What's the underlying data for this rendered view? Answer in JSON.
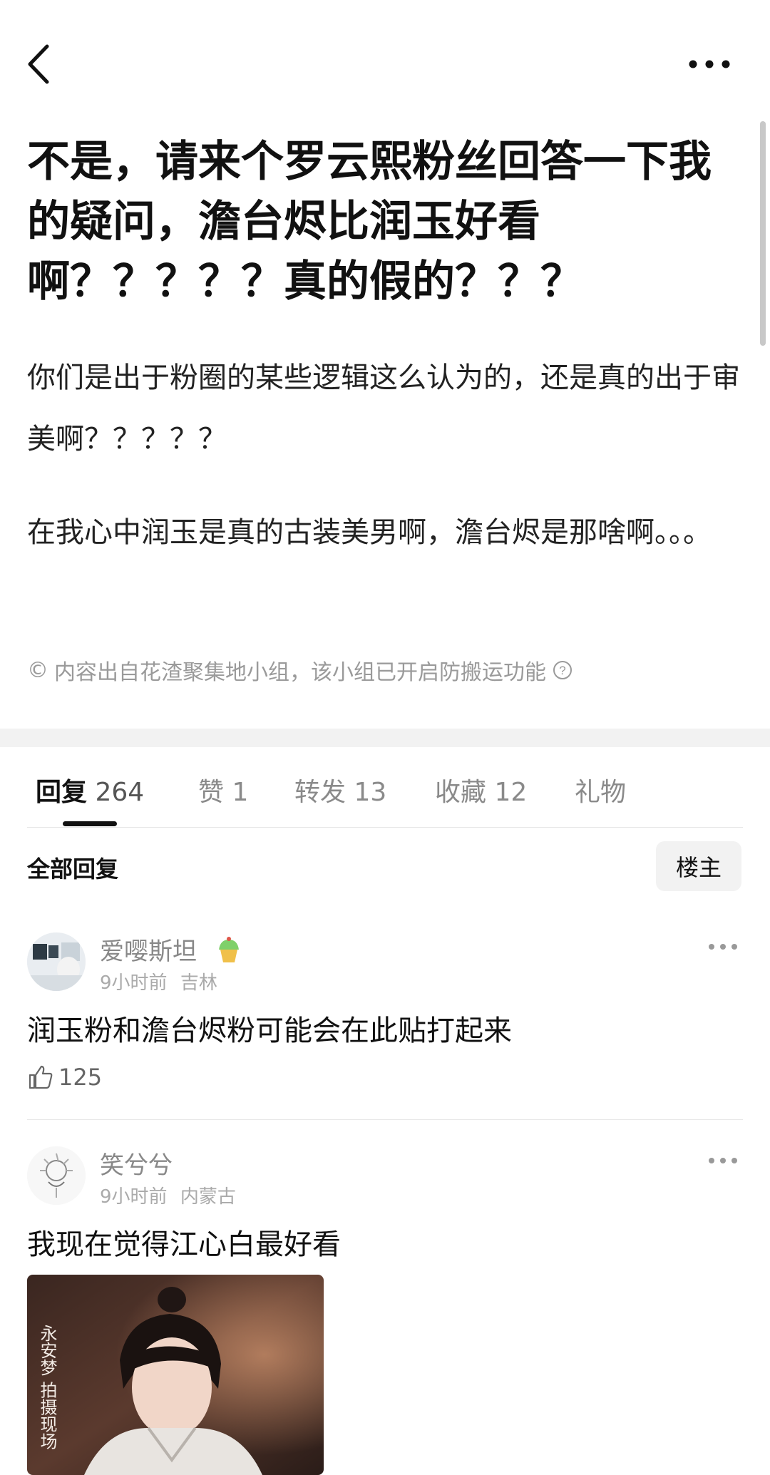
{
  "post": {
    "title": "不是，请来个罗云熙粉丝回答一下我的疑问，澹台烬比润玉好看啊？？？？？真的假的？？？",
    "paragraphs": [
      "你们是出于粉圈的某些逻辑这么认为的，还是真的出于审美啊？？？？？",
      "在我心中润玉是真的古装美男啊，澹台烬是那啥啊。。。"
    ],
    "notice": "内容出自花渣聚集地小组，该小组已开启防搬运功能"
  },
  "tabs": [
    {
      "label": "回复",
      "count": "264"
    },
    {
      "label": "赞",
      "count": "1"
    },
    {
      "label": "转发",
      "count": "13"
    },
    {
      "label": "收藏",
      "count": "12"
    },
    {
      "label": "礼物",
      "count": ""
    }
  ],
  "filter": {
    "all_replies": "全部回复",
    "op_only": "楼主"
  },
  "comments": [
    {
      "username": "爱嘤斯坦",
      "time": "9小时前",
      "location": "吉林",
      "text": "润玉粉和澹台烬粉可能会在此贴打起来",
      "likes": "125"
    },
    {
      "username": "笑兮兮",
      "time": "9小时前",
      "location": "内蒙古",
      "text": "我现在觉得江心白最好看",
      "image_caption": "永安梦 拍摄现场"
    }
  ],
  "colors": {
    "text_primary": "#111111",
    "text_secondary": "#888888",
    "muted": "#aaaaaa",
    "band": "#f2f2f2"
  }
}
